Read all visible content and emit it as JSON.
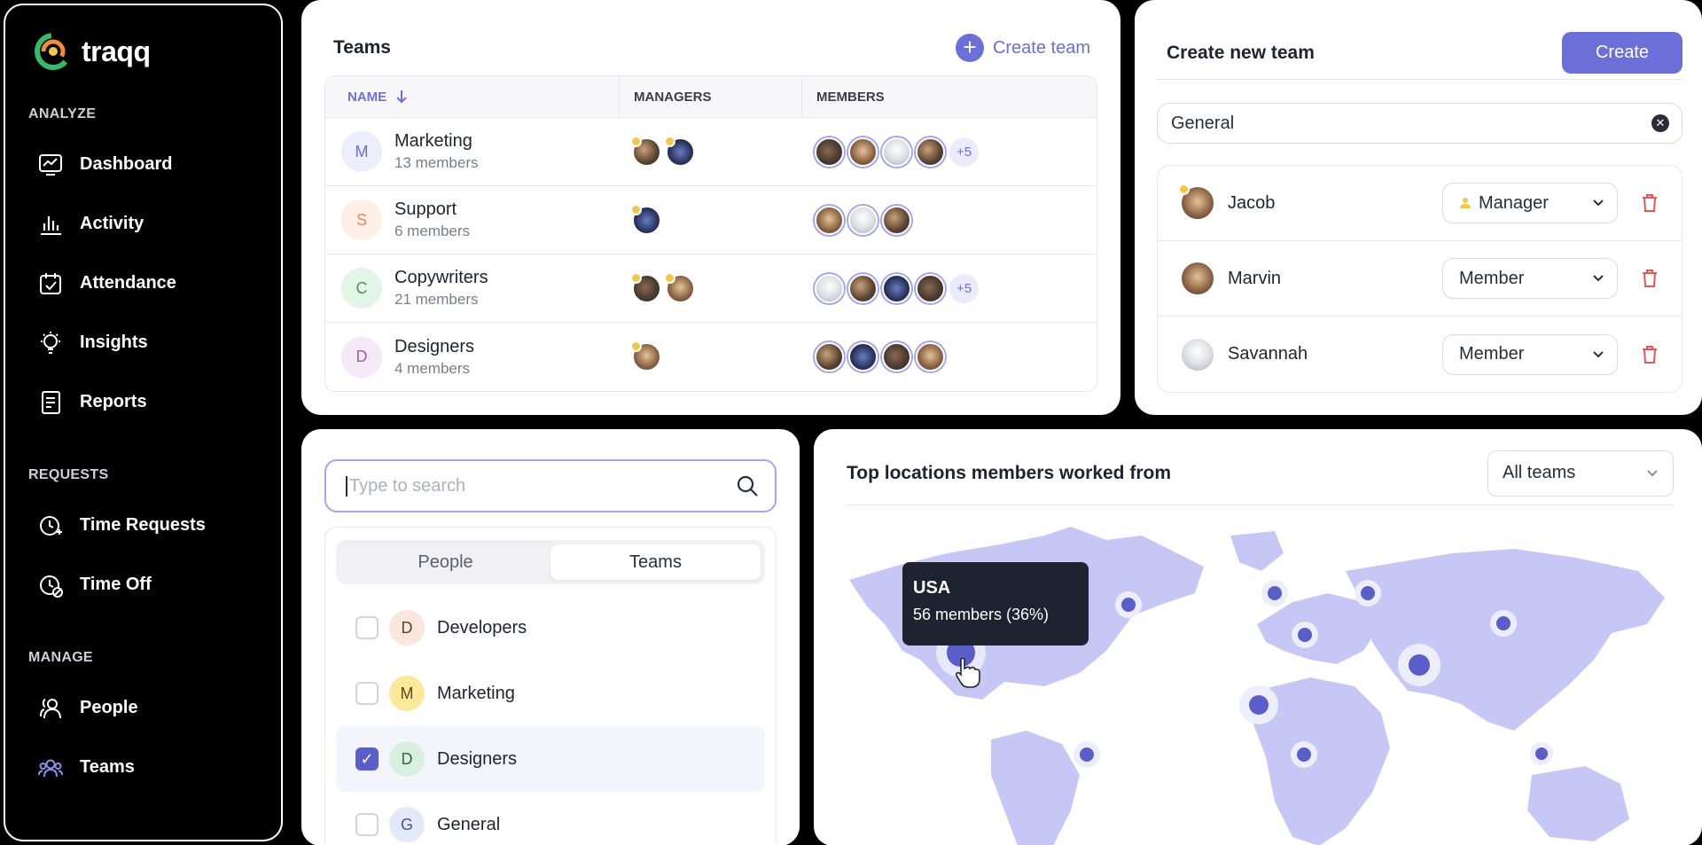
{
  "app": {
    "name": "traqq"
  },
  "colors": {
    "accent": "#6b6fd6",
    "map_land": "#c6c7f4",
    "marker": "#5a5ec9",
    "danger": "#e0565b"
  },
  "sidebar": {
    "sections": [
      {
        "label": "ANALYZE",
        "items": [
          {
            "label": "Dashboard",
            "icon": "dashboard-icon"
          },
          {
            "label": "Activity",
            "icon": "bar-chart-icon"
          },
          {
            "label": "Attendance",
            "icon": "calendar-check-icon"
          },
          {
            "label": "Insights",
            "icon": "lightbulb-icon"
          },
          {
            "label": "Reports",
            "icon": "document-icon"
          }
        ]
      },
      {
        "label": "REQUESTS",
        "items": [
          {
            "label": "Time Requests",
            "icon": "clock-plus-icon"
          },
          {
            "label": "Time Off",
            "icon": "clock-off-icon"
          }
        ]
      },
      {
        "label": "MANAGE",
        "items": [
          {
            "label": "People",
            "icon": "people-icon"
          },
          {
            "label": "Teams",
            "icon": "teams-icon",
            "active": true
          }
        ]
      }
    ]
  },
  "teams_panel": {
    "title": "Teams",
    "create_label": "Create team",
    "columns": {
      "name": "NAME",
      "managers": "MANAGERS",
      "members": "MEMBERS"
    },
    "rows": [
      {
        "initial": "M",
        "name": "Marketing",
        "sub": "13 members",
        "avatar_bg": "#eceefc",
        "avatar_fg": "#6b6fd6",
        "managers": 2,
        "members": 4,
        "more": "+5"
      },
      {
        "initial": "S",
        "name": "Support",
        "sub": "6 members",
        "avatar_bg": "#fdeee6",
        "avatar_fg": "#e08a5a",
        "managers": 1,
        "members": 3,
        "more": ""
      },
      {
        "initial": "C",
        "name": "Copywriters",
        "sub": "21 members",
        "avatar_bg": "#e2f5e6",
        "avatar_fg": "#3f9b57",
        "managers": 2,
        "members": 4,
        "more": "+5"
      },
      {
        "initial": "D",
        "name": "Designers",
        "sub": "4 members",
        "avatar_bg": "#f6e9f7",
        "avatar_fg": "#a05cab",
        "managers": 1,
        "members": 4,
        "more": ""
      }
    ]
  },
  "create_panel": {
    "title": "Create new team",
    "create_button": "Create",
    "team_name_value": "General",
    "members": [
      {
        "name": "Jacob",
        "role": "Manager",
        "is_manager": true
      },
      {
        "name": "Marvin",
        "role": "Member",
        "is_manager": false
      },
      {
        "name": "Savannah",
        "role": "Member",
        "is_manager": false
      }
    ]
  },
  "search_panel": {
    "placeholder": "Type to search",
    "tabs": [
      "People",
      "Teams"
    ],
    "active_tab": "Teams",
    "options": [
      {
        "initial": "D",
        "label": "Developers",
        "checked": false,
        "bg": "#fbe6dd",
        "fg": "#5a4030"
      },
      {
        "initial": "M",
        "label": "Marketing",
        "checked": false,
        "bg": "#fbe89a",
        "fg": "#5a4a10"
      },
      {
        "initial": "D",
        "label": "Designers",
        "checked": true,
        "bg": "#d9efdf",
        "fg": "#2f6b41"
      },
      {
        "initial": "G",
        "label": "General",
        "checked": false,
        "bg": "#e3e9f8",
        "fg": "#4b5a8a"
      }
    ]
  },
  "map_panel": {
    "title": "Top locations members worked from",
    "filter": "All teams",
    "tooltip": {
      "title": "USA",
      "sub": "56 members (36%)"
    }
  }
}
